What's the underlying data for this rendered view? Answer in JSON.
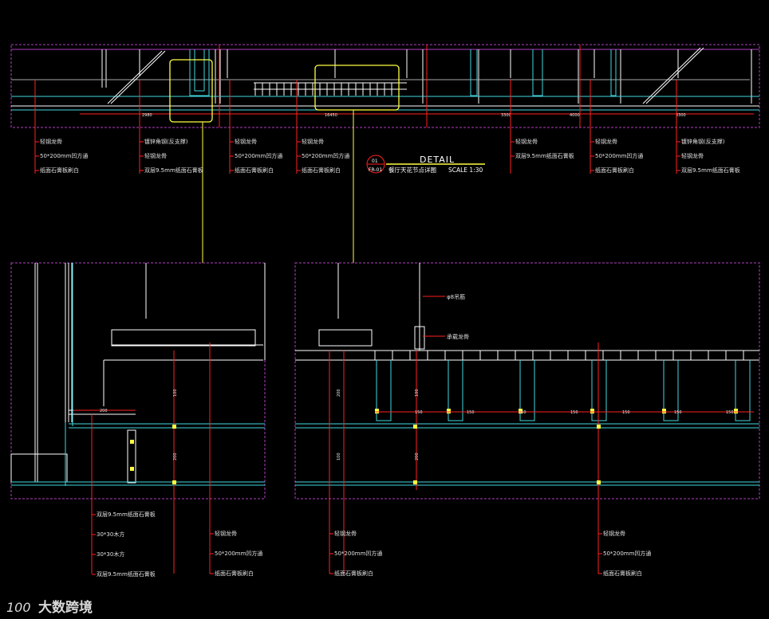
{
  "detail_title": {
    "heading": "DETAIL",
    "number": "01",
    "sheet_ref": "FR-01",
    "name": "餐厅天花节点详图",
    "scale": "SCALE 1:30"
  },
  "top_dimensions": [
    "2980",
    "16450",
    "3300",
    "4000",
    "3300"
  ],
  "top_annotations": [
    [
      "轻钢龙骨",
      "50*200mm凹方通",
      "纸面石膏板刷白"
    ],
    [
      "镀锌角钢(反支撑)",
      "轻钢龙骨",
      "双层9.5mm纸面石膏板"
    ],
    [
      "轻钢龙骨",
      "50*200mm凹方通",
      "纸面石膏板刷白"
    ],
    [
      "轻钢龙骨",
      "50*200mm凹方通",
      "纸面石膏板刷白"
    ],
    [
      "轻钢龙骨",
      "双层9.5mm纸面石膏板"
    ],
    [
      "轻钢龙骨",
      "50*200mm凹方通",
      "纸面石膏板刷白"
    ],
    [
      "镀锌角钢(反支撑)",
      "轻钢龙骨",
      "双层9.5mm纸面石膏板"
    ]
  ],
  "left_detail": {
    "dims": [
      "200",
      "100",
      "200"
    ],
    "notes_left": [
      "双层9.5mm纸面石膏板",
      "30*30木方",
      "30*30木方",
      "双层9.5mm纸面石膏板"
    ],
    "notes_right": [
      "轻钢龙骨",
      "50*200mm凹方通",
      "纸面石膏板刷白"
    ]
  },
  "right_detail": {
    "callouts": [
      "φ8吊筋",
      "承载龙骨"
    ],
    "dims_h": [
      "150",
      "150",
      "150",
      "150",
      "150",
      "150",
      "150"
    ],
    "dims_v": [
      "200",
      "100",
      "200",
      "100"
    ],
    "notes_a": [
      "轻钢龙骨",
      "50*200mm凹方通",
      "纸面石膏板刷白"
    ],
    "notes_b": [
      "轻钢龙骨",
      "50*200mm凹方通",
      "纸面石膏板刷白"
    ]
  },
  "watermark": {
    "logo": "100",
    "text": "大数跨境"
  },
  "colors": {
    "background": "#000000",
    "frame": "#b040c0",
    "structure": "#ffffff",
    "board": "#40d8e0",
    "leader": "#ff2020",
    "highlight": "#ffff40",
    "text": "#e0e0e0"
  }
}
